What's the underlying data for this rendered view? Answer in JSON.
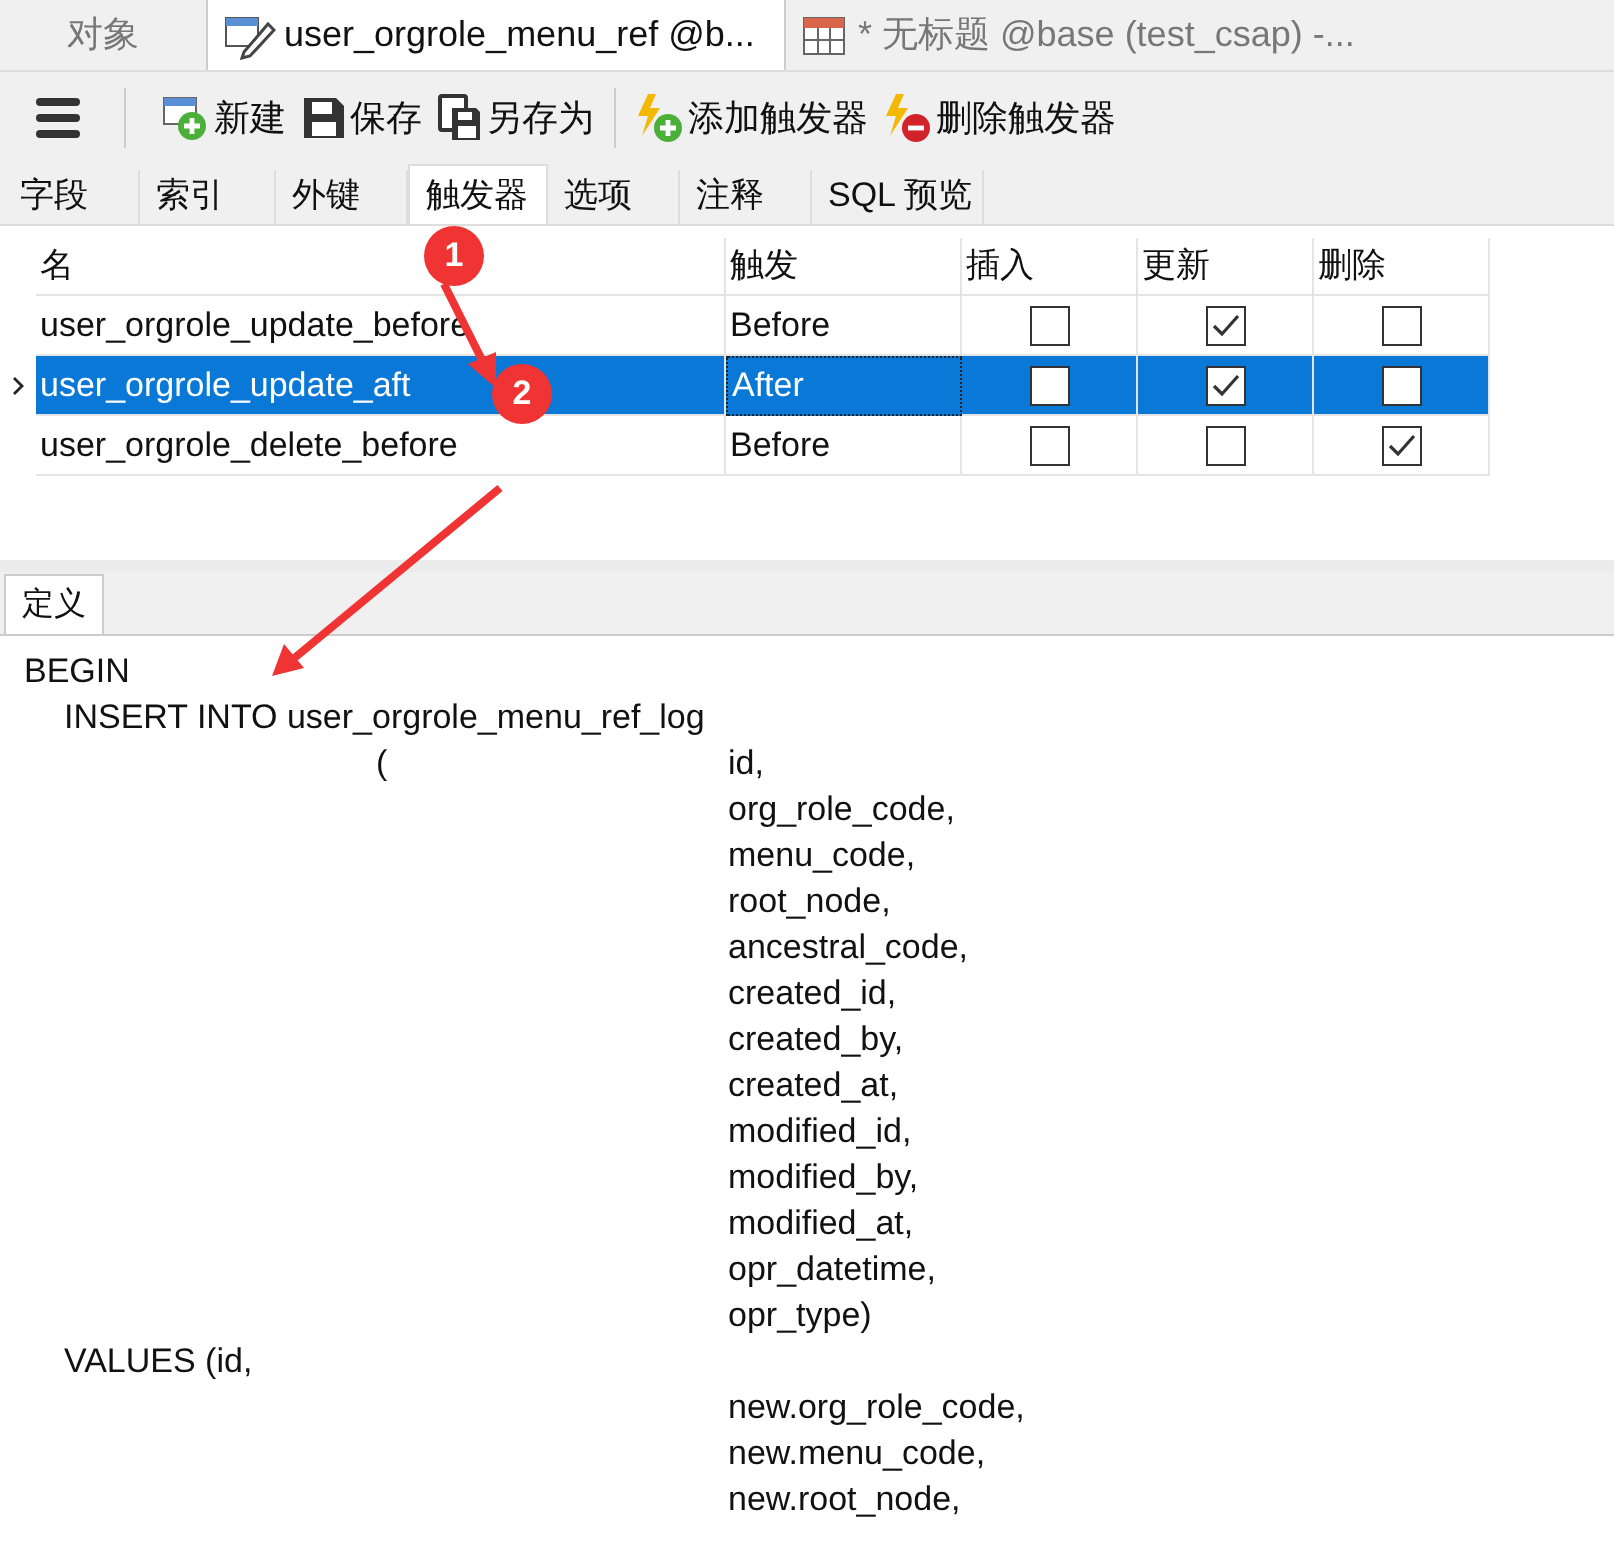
{
  "doc_tabs": [
    {
      "label": "对象",
      "selected": false
    },
    {
      "label": "user_orgrole_menu_ref @b...",
      "selected": true
    },
    {
      "label": "* 无标题 @base (test_csap) -...",
      "selected": false
    }
  ],
  "toolbar": [
    {
      "label": "新建"
    },
    {
      "label": "保存"
    },
    {
      "label": "另存为"
    },
    {
      "label": "添加触发器"
    },
    {
      "label": "删除触发器"
    }
  ],
  "sub_tabs": [
    {
      "label": "字段",
      "selected": false
    },
    {
      "label": "索引",
      "selected": false
    },
    {
      "label": "外键",
      "selected": false
    },
    {
      "label": "触发器",
      "selected": true
    },
    {
      "label": "选项",
      "selected": false
    },
    {
      "label": "注释",
      "selected": false
    },
    {
      "label": "SQL 预览",
      "selected": false
    }
  ],
  "table": {
    "columns": [
      "名",
      "触发",
      "插入",
      "更新",
      "删除"
    ],
    "rows": [
      {
        "name": "user_orgrole_update_before",
        "fire": "Before",
        "insert": false,
        "update": true,
        "delete": false,
        "selected": false
      },
      {
        "name": "user_orgrole_update_aft",
        "fire": "After",
        "insert": false,
        "update": true,
        "delete": false,
        "selected": true
      },
      {
        "name": "user_orgrole_delete_before",
        "fire": "Before",
        "insert": false,
        "update": false,
        "delete": true,
        "selected": false
      }
    ]
  },
  "definition": {
    "tab": "定义",
    "lines": [
      [
        {
          "kind": "block",
          "text": "BEGIN"
        }
      ],
      [
        {
          "kind": "statement",
          "text": "INSERT INTO user_orgrole_menu_ref_log"
        }
      ],
      [
        {
          "kind": "paren",
          "text": "("
        },
        {
          "kind": "column",
          "text": "id,"
        }
      ],
      [
        {
          "kind": "column",
          "text": "org_role_code,"
        }
      ],
      [
        {
          "kind": "column",
          "text": "menu_code,"
        }
      ],
      [
        {
          "kind": "column",
          "text": "root_node,"
        }
      ],
      [
        {
          "kind": "column",
          "text": "ancestral_code,"
        }
      ],
      [
        {
          "kind": "column",
          "text": "created_id,"
        }
      ],
      [
        {
          "kind": "column",
          "text": "created_by,"
        }
      ],
      [
        {
          "kind": "column",
          "text": "created_at,"
        }
      ],
      [
        {
          "kind": "column",
          "text": "modified_id,"
        }
      ],
      [
        {
          "kind": "column",
          "text": "modified_by,"
        }
      ],
      [
        {
          "kind": "column",
          "text": "modified_at,"
        }
      ],
      [
        {
          "kind": "column",
          "text": "opr_datetime,"
        }
      ],
      [
        {
          "kind": "column",
          "text": "opr_type)"
        }
      ],
      [
        {
          "kind": "statement",
          "text": "VALUES (id,"
        }
      ],
      [
        {
          "kind": "column",
          "text": "new.org_role_code,"
        }
      ],
      [
        {
          "kind": "column",
          "text": "new.menu_code,"
        }
      ],
      [
        {
          "kind": "column",
          "text": "new.root_node,"
        }
      ]
    ]
  },
  "annotations": [
    "1",
    "2"
  ]
}
